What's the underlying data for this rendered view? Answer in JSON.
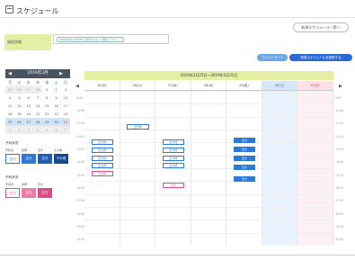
{
  "header": {
    "title": "スケジュール",
    "other_button": "新規スケジュール一覧へ"
  },
  "facility": {
    "label": "施設詳細",
    "tag": "HARMONY HOTEL 大阪マリオット都ホテル ×"
  },
  "actions": {
    "print": "プリントモード",
    "new": "新規スケジュールを登録する"
  },
  "mini_calendar": {
    "month": "2019年3月",
    "prev": "◀",
    "next": "▶",
    "dow": [
      "月",
      "火",
      "水",
      "木",
      "金",
      "土",
      "日"
    ],
    "weeks": [
      [
        "25",
        "26",
        "27",
        "28",
        "1",
        "2",
        "3"
      ],
      [
        "4",
        "5",
        "6",
        "7",
        "8",
        "9",
        "10"
      ],
      [
        "11",
        "12",
        "13",
        "14",
        "15",
        "16",
        "17"
      ],
      [
        "18",
        "19",
        "20",
        "21",
        "22",
        "23",
        "24"
      ],
      [
        "25",
        "26",
        "27",
        "28",
        "29",
        "30",
        "31"
      ],
      [
        "1",
        "2",
        "3",
        "4",
        "5",
        "6",
        "7"
      ]
    ]
  },
  "legend": {
    "status_title": "予約状況",
    "status_items": [
      "予約済",
      "仮押",
      "空き",
      "その他"
    ],
    "status_chips": [
      "空き",
      "空き",
      "空き",
      "その他"
    ],
    "filter_title": "予約状況",
    "filter_items": [
      "予約済",
      "仮押",
      "空き"
    ],
    "filter_chips": [
      "空き",
      "空き",
      "空き"
    ]
  },
  "schedule": {
    "range": "2019年3月25日〜2019年3月31日",
    "days": [
      "25(月)",
      "26(火)",
      "27(水)",
      "28(木)",
      "29(金)",
      "30(土)",
      "31(日)"
    ],
    "times": [
      "9:00",
      "10:00",
      "11:00",
      "12:00",
      "13:00",
      "14:00",
      "15:00",
      "16:00",
      "17:00",
      "18:00",
      "19:00",
      "20:00"
    ],
    "events": [
      {
        "day": 1,
        "row": 2.6,
        "label": "空き枠",
        "style": "outline"
      },
      {
        "day": 0,
        "row": 3.8,
        "label": "空き枠",
        "style": "outline"
      },
      {
        "day": 0,
        "row": 4.4,
        "label": "空き枠",
        "style": "outline"
      },
      {
        "day": 0,
        "row": 5.0,
        "label": "空き枠",
        "style": "outline"
      },
      {
        "day": 0,
        "row": 5.6,
        "label": "空き枠",
        "style": "outline"
      },
      {
        "day": 0,
        "row": 6.2,
        "label": "空き枠",
        "style": "pink"
      },
      {
        "day": 2,
        "row": 3.8,
        "label": "空き枠",
        "style": "outline"
      },
      {
        "day": 2,
        "row": 4.4,
        "label": "空き枠",
        "style": "outline"
      },
      {
        "day": 2,
        "row": 5.0,
        "label": "空き枠",
        "style": "outline"
      },
      {
        "day": 2,
        "row": 5.6,
        "label": "空き枠",
        "style": "outline"
      },
      {
        "day": 2,
        "row": 7.1,
        "label": "空き",
        "style": "pink"
      },
      {
        "day": 4,
        "row": 3.6,
        "label": "空き",
        "style": "blue"
      },
      {
        "day": 4,
        "row": 4.3,
        "label": "空き",
        "style": "blue"
      },
      {
        "day": 4,
        "row": 5.0,
        "label": "空き",
        "style": "blue"
      },
      {
        "day": 4,
        "row": 5.7,
        "label": "空き",
        "style": "blue"
      },
      {
        "day": 4,
        "row": 6.6,
        "label": "空き",
        "style": "blue"
      }
    ]
  }
}
